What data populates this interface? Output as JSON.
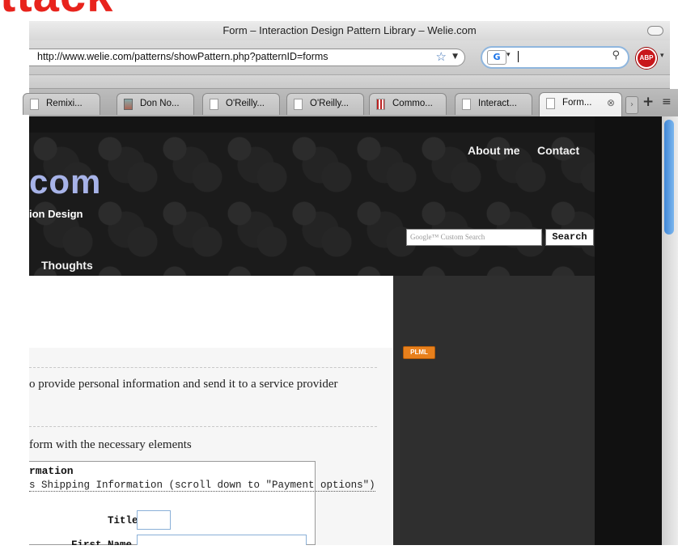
{
  "header_fragment": "ttack",
  "window": {
    "title": "Form – Interaction Design Pattern Library – Welie.com"
  },
  "toolbar": {
    "url": "http://www.welie.com/patterns/showPattern.php?patternID=forms",
    "search_engine_badge": "G",
    "abp_label": "ABP"
  },
  "tabs": [
    {
      "label": "Remixi...",
      "icon": "page-icon"
    },
    {
      "label": "Don No...",
      "icon": "photo-icon"
    },
    {
      "label": "O'Reilly...",
      "icon": "page-icon"
    },
    {
      "label": "O'Reilly...",
      "icon": "page-icon"
    },
    {
      "label": "Commo...",
      "icon": "flickr-icon"
    },
    {
      "label": "Interact...",
      "icon": "page-icon"
    },
    {
      "label": "Form...",
      "icon": "page-icon",
      "active": true
    }
  ],
  "site": {
    "logo_fragment": "com",
    "tagline_fragment": "ion Design",
    "nav": {
      "about": "About me",
      "contact": "Contact",
      "thoughts": "Thoughts"
    },
    "search": {
      "placeholder": "Google™ Custom Search",
      "button": "Search"
    }
  },
  "sidebar": {
    "badge": "PLML"
  },
  "content": {
    "problem_text": "o provide personal information and send it to a service provider",
    "solution_text": "form with the necessary elements",
    "form": {
      "heading": "rmation",
      "subheading": "s Shipping Information (scroll down to \"Payment options\")",
      "title_label": "Title",
      "first_name_label": "First Name"
    }
  },
  "colors": {
    "accent_red": "#e8231c",
    "logo_blue": "#a7b3e8",
    "badge_orange": "#e8801c",
    "scroll_blue": "#3f86d6"
  }
}
